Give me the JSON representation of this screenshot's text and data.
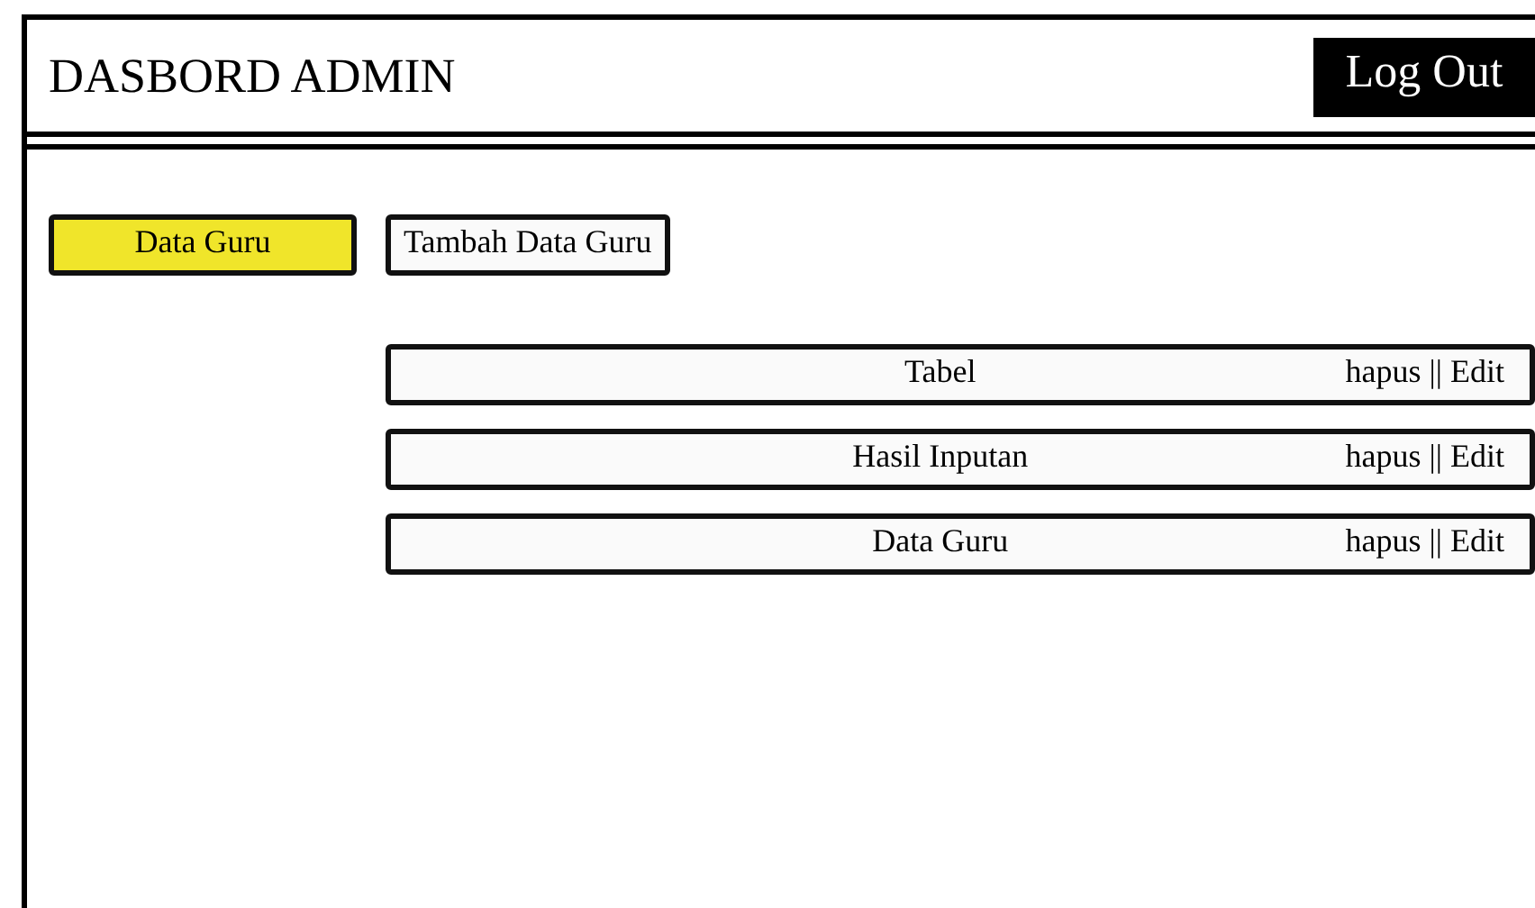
{
  "header": {
    "title": "DASBORD ADMIN",
    "logout": "Log Out"
  },
  "nav": [
    {
      "label": "Data Guru",
      "selected": true
    },
    {
      "label": "Tambah Data Guru",
      "selected": false
    }
  ],
  "rows": [
    {
      "label": "Tabel",
      "actions": "hapus || Edit"
    },
    {
      "label": "Hasil Inputan",
      "actions": "hapus || Edit"
    },
    {
      "label": "Data Guru",
      "actions": "hapus || Edit"
    }
  ]
}
